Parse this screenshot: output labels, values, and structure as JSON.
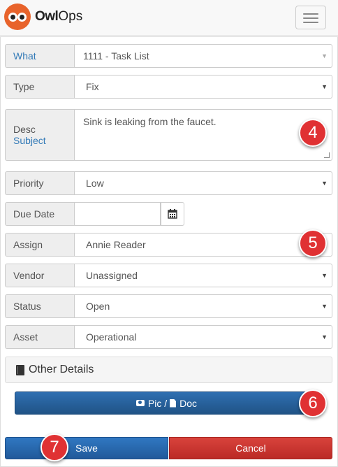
{
  "brand": {
    "name_bold": "Owl",
    "name_rest": "Ops"
  },
  "form": {
    "what": {
      "label": "What",
      "value": "1111 - Task List"
    },
    "type": {
      "label": "Type",
      "value": "Fix"
    },
    "desc": {
      "label_line1": "Desc",
      "label_line2": "Subject",
      "value": "Sink is leaking from the faucet."
    },
    "priority": {
      "label": "Priority",
      "value": "Low"
    },
    "due_date": {
      "label": "Due Date",
      "value": ""
    },
    "assign": {
      "label": "Assign",
      "value": "Annie Reader"
    },
    "vendor": {
      "label": "Vendor",
      "value": "Unassigned"
    },
    "status": {
      "label": "Status",
      "value": "Open"
    },
    "asset": {
      "label": "Asset",
      "value": "Operational"
    }
  },
  "other_details": {
    "label": "Other Details"
  },
  "attach": {
    "pic_label": "Pic /",
    "doc_label": "Doc"
  },
  "actions": {
    "save_label": "Save",
    "cancel_label": "Cancel"
  },
  "callouts": [
    "4",
    "5",
    "6",
    "7"
  ],
  "icons": {
    "dropdown": "caret-down-icon",
    "calendar": "calendar-icon",
    "menu": "hamburger-menu-icon",
    "book": "book-icon",
    "camera": "camera-icon",
    "file": "file-icon"
  },
  "colors": {
    "brand": "#e8632b",
    "primary": "#2a64a2",
    "danger": "#c9302c",
    "callout": "#e03133",
    "link": "#337ab7"
  }
}
